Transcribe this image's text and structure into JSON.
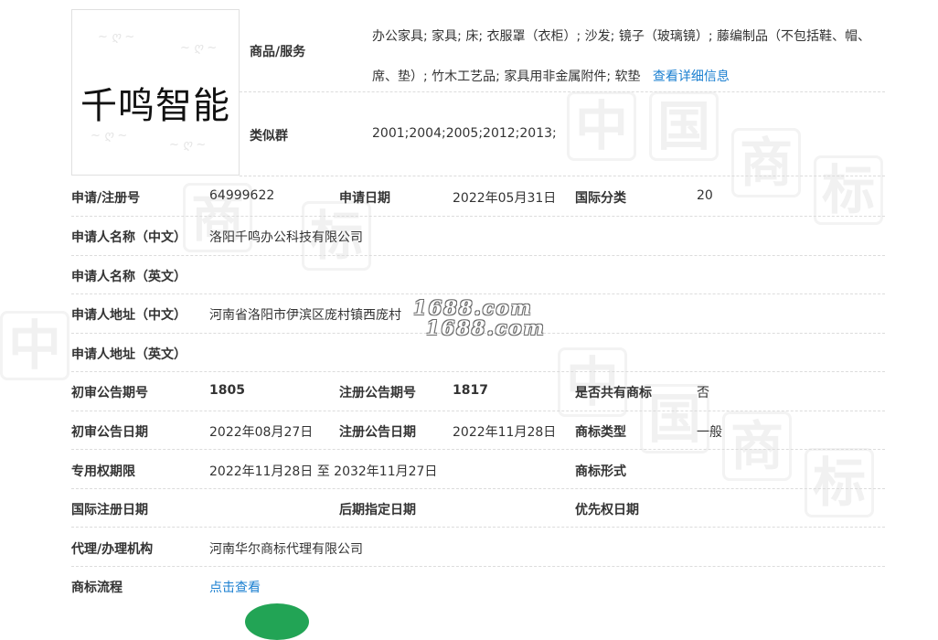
{
  "logo": {
    "text": "千鸣智能"
  },
  "goods": {
    "label": "商品/服务",
    "text": "办公家具; 家具; 床; 衣服罩（衣柜）; 沙发; 镜子（玻璃镜）; 藤编制品（不包括鞋、帽、席、垫）; 竹木工艺品; 家具用非金属附件; 软垫",
    "more_link": "查看详细信息"
  },
  "similar_group": {
    "label": "类似群",
    "value": "2001;2004;2005;2012;2013;"
  },
  "rows": {
    "reg_no": {
      "label": "申请/注册号",
      "value": "64999622"
    },
    "apply_date": {
      "label": "申请日期",
      "value": "2022年05月31日"
    },
    "intl_class": {
      "label": "国际分类",
      "value": "20"
    },
    "applicant_cn": {
      "label": "申请人名称（中文）",
      "value": "洛阳千鸣办公科技有限公司"
    },
    "applicant_en": {
      "label": "申请人名称（英文）",
      "value": ""
    },
    "address_cn": {
      "label": "申请人地址（中文）",
      "value": "河南省洛阳市伊滨区庞村镇西庞村"
    },
    "address_en": {
      "label": "申请人地址（英文）",
      "value": ""
    },
    "prelim_issue": {
      "label": "初审公告期号",
      "value": "1805"
    },
    "reg_issue": {
      "label": "注册公告期号",
      "value": "1817"
    },
    "shared": {
      "label": "是否共有商标",
      "value": "否"
    },
    "prelim_date": {
      "label": "初审公告日期",
      "value": "2022年08月27日"
    },
    "reg_date": {
      "label": "注册公告日期",
      "value": "2022年11月28日"
    },
    "tm_type": {
      "label": "商标类型",
      "value": "一般"
    },
    "exclusive_period": {
      "label": "专用权期限",
      "value": "2022年11月28日 至 2032年11月27日"
    },
    "tm_form": {
      "label": "商标形式",
      "value": ""
    },
    "intl_reg_date": {
      "label": "国际注册日期",
      "value": ""
    },
    "later_designation": {
      "label": "后期指定日期",
      "value": ""
    },
    "priority_date": {
      "label": "优先权日期",
      "value": ""
    },
    "agent": {
      "label": "代理/办理机构",
      "value": "河南华尔商标代理有限公司"
    },
    "process": {
      "label": "商标流程",
      "link": "点击查看"
    }
  },
  "watermark": {
    "line1": "1688.com",
    "line2": "1688.com",
    "tile_chars": [
      "中",
      "国",
      "商",
      "标"
    ]
  }
}
